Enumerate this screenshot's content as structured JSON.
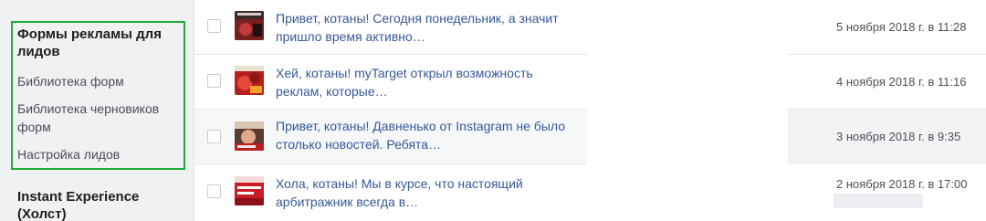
{
  "sidebar": {
    "section1_title": "Формы рекламы для лидов",
    "items": [
      {
        "label": "Библиотека форм"
      },
      {
        "label": "Библиотека черновиков форм"
      },
      {
        "label": "Настройка лидов"
      }
    ],
    "section2_title": "Instant Experience (Холст)"
  },
  "rows": [
    {
      "text": "Привет, котаны! Сегодня понедельник, а значит пришло время активно…",
      "date": "5 ноября 2018 г. в 11:28"
    },
    {
      "text": "Хей, котаны! myTarget открыл возможность реклам, которые…",
      "date": "4 ноября 2018 г. в 11:16"
    },
    {
      "text": "Привет, котаны! Давненько от Instagram не было столько новостей. Ребята…",
      "date": "3 ноября 2018 г. в 9:35"
    },
    {
      "text": "Хола, котаны! Мы в курсе, что настоящий арбитражник всегда в…",
      "date": "2 ноября 2018 г. в 17:00"
    }
  ],
  "colors": {
    "highlight": "#1faa3c",
    "link": "#365899"
  }
}
